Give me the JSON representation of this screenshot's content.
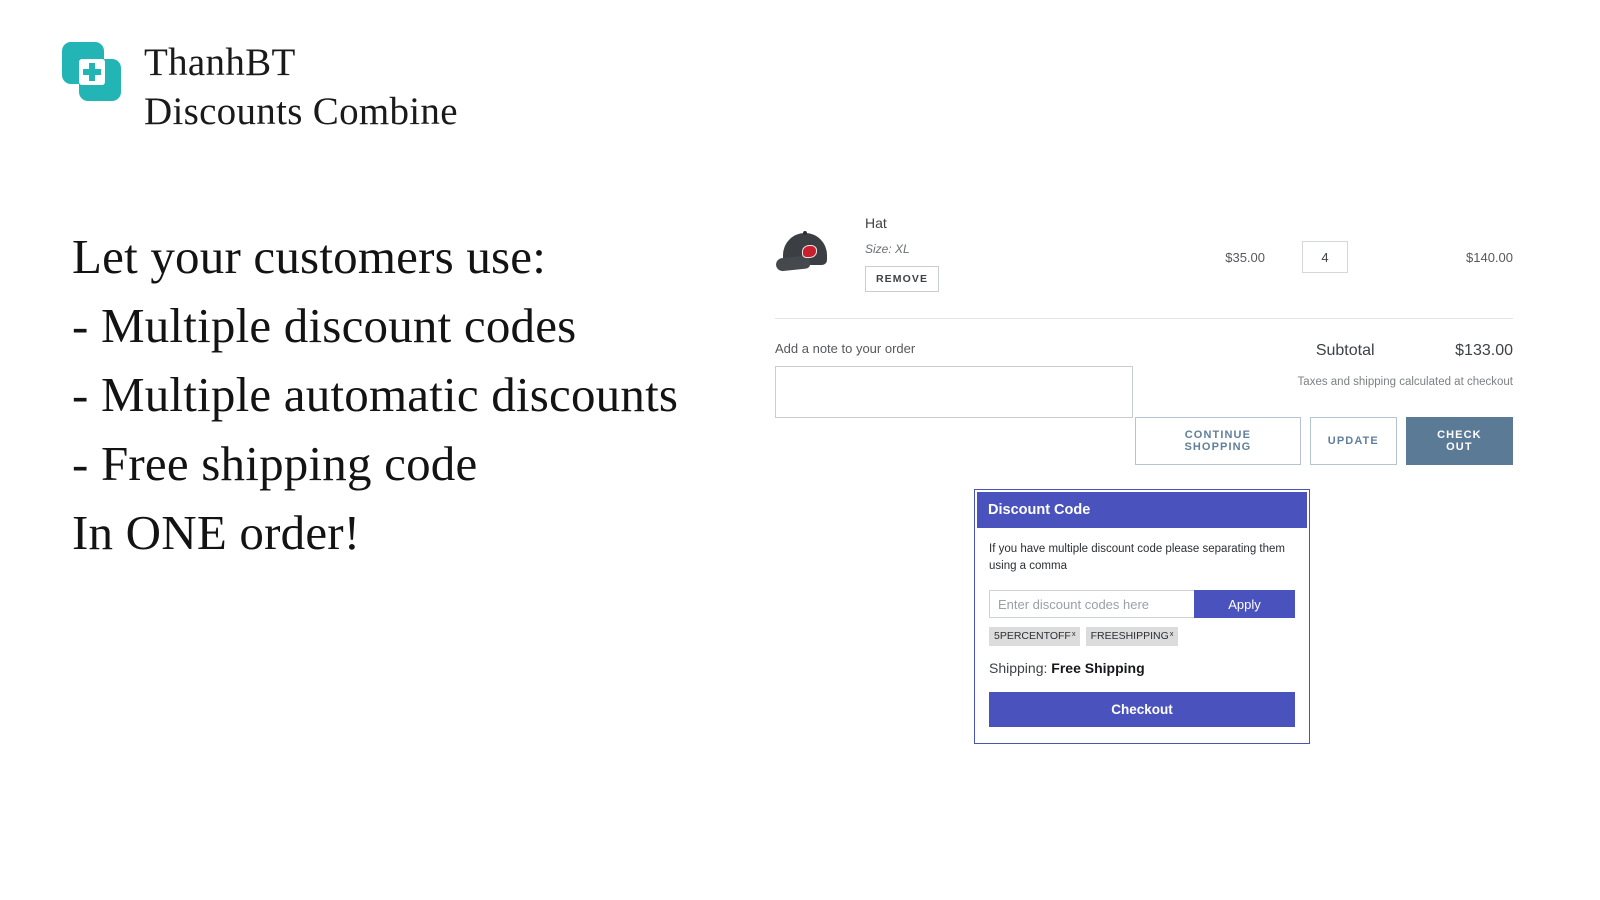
{
  "brand": {
    "logo_icon": "overlapping-squares-plus-icon",
    "line1": "ThanhBT",
    "line2": "Discounts Combine",
    "accent_color": "#23b5b5"
  },
  "headline": {
    "line1": "Let your customers use:",
    "line2": "- Multiple discount codes",
    "line3": "- Multiple automatic discounts",
    "line4": "- Free shipping code",
    "line5": "In ONE order!"
  },
  "cart": {
    "item": {
      "thumbnail_icon": "baseball-cap-image",
      "title": "Hat",
      "variant": "Size: XL",
      "remove_label": "REMOVE",
      "unit_price": "$35.00",
      "quantity": "4",
      "line_total": "$140.00"
    },
    "note": {
      "label": "Add a note to your order",
      "value": "",
      "placeholder": ""
    },
    "subtotal_label": "Subtotal",
    "subtotal_value": "$133.00",
    "tax_note": "Taxes and shipping calculated at checkout",
    "buttons": {
      "continue_shopping": "CONTINUE SHOPPING",
      "update": "UPDATE",
      "check_out": "CHECK OUT"
    },
    "checkout_color": "#5a7a96"
  },
  "discount_panel": {
    "header": "Discount Code",
    "hint": "If you have multiple discount code please separating them using a comma",
    "input_placeholder": "Enter discount codes here",
    "input_value": "",
    "apply_label": "Apply",
    "tags": [
      {
        "label": "5PERCENTOFF",
        "remove_icon": "x"
      },
      {
        "label": "FREESHIPPING",
        "remove_icon": "x"
      }
    ],
    "shipping_label": "Shipping:",
    "shipping_value": "Free Shipping",
    "checkout_label": "Checkout",
    "accent_color": "#4a53bd"
  }
}
